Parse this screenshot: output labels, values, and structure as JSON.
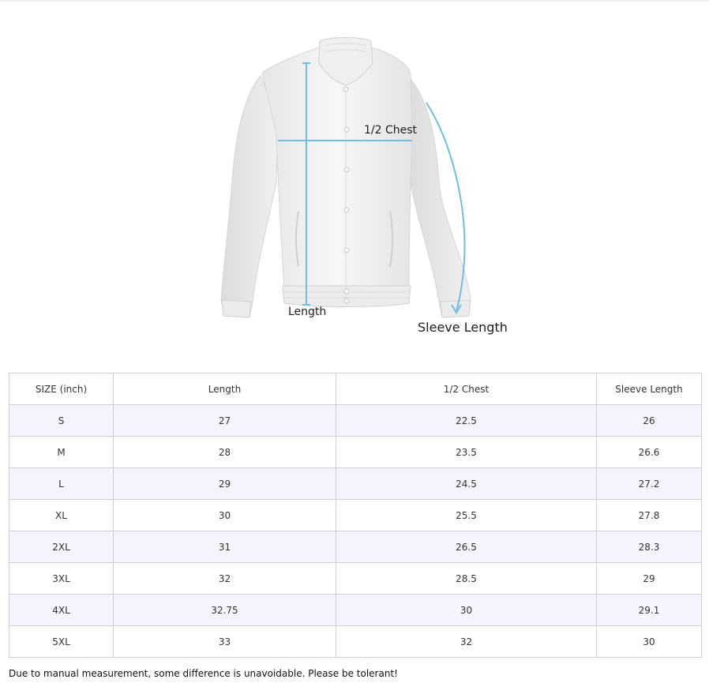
{
  "figure": {
    "labels": {
      "chest": "1/2 Chest",
      "length": "Length",
      "sleeve": "Sleeve Length"
    },
    "colors": {
      "measure_line": "#6fbfe3",
      "jacket": "#f1f1f1"
    }
  },
  "table": {
    "headers": [
      "SIZE (inch)",
      "Length",
      "1/2 Chest",
      "Sleeve Length"
    ],
    "rows": [
      [
        "S",
        "27",
        "22.5",
        "26"
      ],
      [
        "M",
        "28",
        "23.5",
        "26.6"
      ],
      [
        "L",
        "29",
        "24.5",
        "27.2"
      ],
      [
        "XL",
        "30",
        "25.5",
        "27.8"
      ],
      [
        "2XL",
        "31",
        "26.5",
        "28.3"
      ],
      [
        "3XL",
        "32",
        "28.5",
        "29"
      ],
      [
        "4XL",
        "32.75",
        "30",
        "29.1"
      ],
      [
        "5XL",
        "33",
        "32",
        "30"
      ]
    ],
    "colors": {
      "stripe": "#f7f3fd",
      "border": "#cfcfcf"
    }
  },
  "footnote": "Due to manual measurement, some difference is unavoidable. Please be tolerant!"
}
